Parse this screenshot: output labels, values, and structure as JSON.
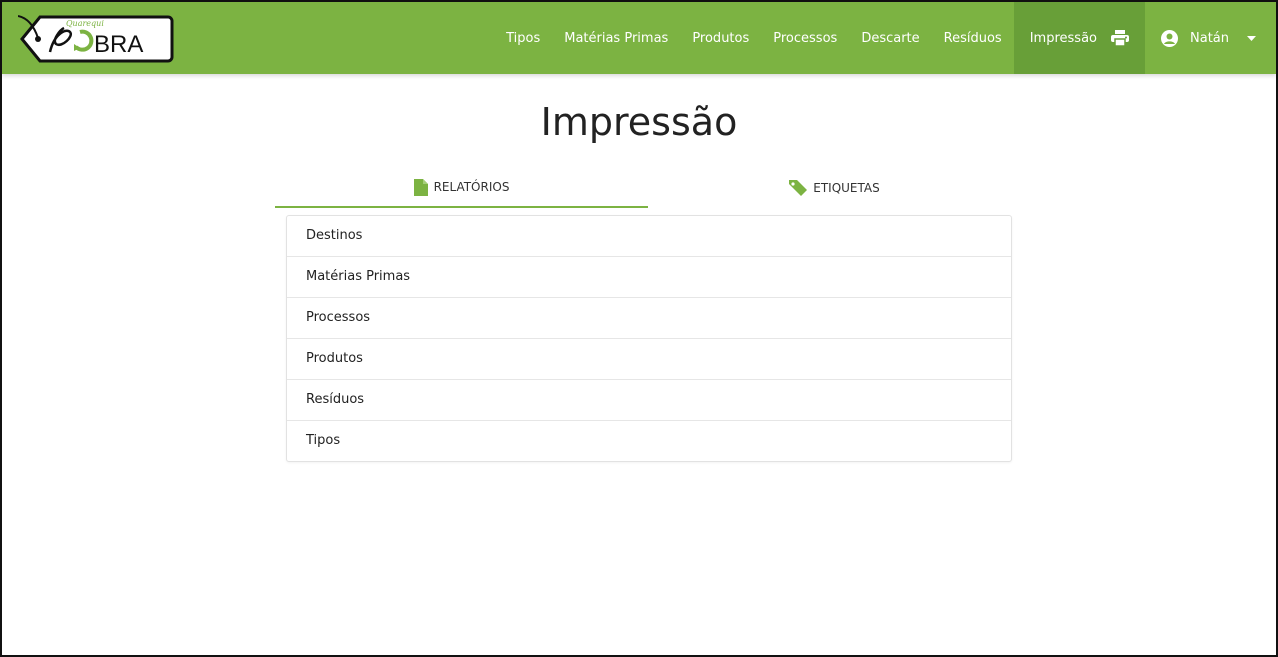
{
  "header": {
    "logo": {
      "script_text": "Quarequi",
      "wordmark": "BRA"
    },
    "nav": [
      {
        "label": "Tipos"
      },
      {
        "label": "Matérias Primas"
      },
      {
        "label": "Produtos"
      },
      {
        "label": "Processos"
      },
      {
        "label": "Descarte"
      },
      {
        "label": "Resíduos"
      }
    ],
    "active_item": {
      "label": "Impressão",
      "icon": "printer-icon"
    },
    "user": {
      "name": "Natán",
      "icon": "user-circle-icon"
    }
  },
  "main": {
    "title": "Impressão",
    "tabs": [
      {
        "label": "RELATÓRIOS",
        "icon": "file-icon"
      },
      {
        "label": "ETIQUETAS",
        "icon": "tag-icon"
      }
    ],
    "reports": [
      {
        "label": "Destinos"
      },
      {
        "label": "Matérias Primas"
      },
      {
        "label": "Processos"
      },
      {
        "label": "Produtos"
      },
      {
        "label": "Resíduos"
      },
      {
        "label": "Tipos"
      }
    ]
  },
  "colors": {
    "navbar": "#7cb342",
    "navbar_active": "#689f38",
    "tab_underline": "#7cb342",
    "icon_green": "#7cb342"
  }
}
